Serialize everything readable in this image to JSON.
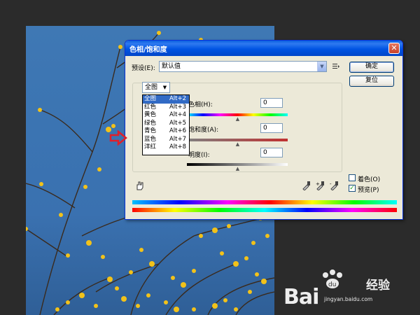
{
  "dialog": {
    "title": "色相/饱和度",
    "close_label": "✕",
    "preset_label": "预设(E):",
    "preset_value": "默认值",
    "ok_label": "确定",
    "reset_label": "复位",
    "channel_value": "全图",
    "hue": {
      "label": "色相(H):",
      "value": "0",
      "level": 0.5
    },
    "saturation": {
      "label": "饱和度(A):",
      "value": "0",
      "level": 0.5
    },
    "lightness": {
      "label": "明度(I):",
      "value": "0",
      "level": 0.5
    },
    "colorize_label": "着色(O)",
    "colorize_checked": false,
    "preview_label": "预览(P)",
    "preview_checked": true
  },
  "channel_dropdown": {
    "items": [
      {
        "name": "全图",
        "shortcut": "Alt+2",
        "selected": true
      },
      {
        "name": "红色",
        "shortcut": "Alt+3"
      },
      {
        "name": "黄色",
        "shortcut": "Alt+4"
      },
      {
        "name": "绿色",
        "shortcut": "Alt+5"
      },
      {
        "name": "青色",
        "shortcut": "Alt+6"
      },
      {
        "name": "蓝色",
        "shortcut": "Alt+7"
      },
      {
        "name": "洋红",
        "shortcut": "Alt+8"
      }
    ]
  },
  "watermark": {
    "brand": "Bai",
    "brand_suffix": "经验",
    "url": "jingyan.baidu.com"
  },
  "colors": {
    "title_bar": "#0054e3",
    "dialog_bg": "#ece9d8",
    "selection": "#316ac5",
    "annotation_arrow": "#e0202a",
    "sky": "#3b74b2"
  }
}
